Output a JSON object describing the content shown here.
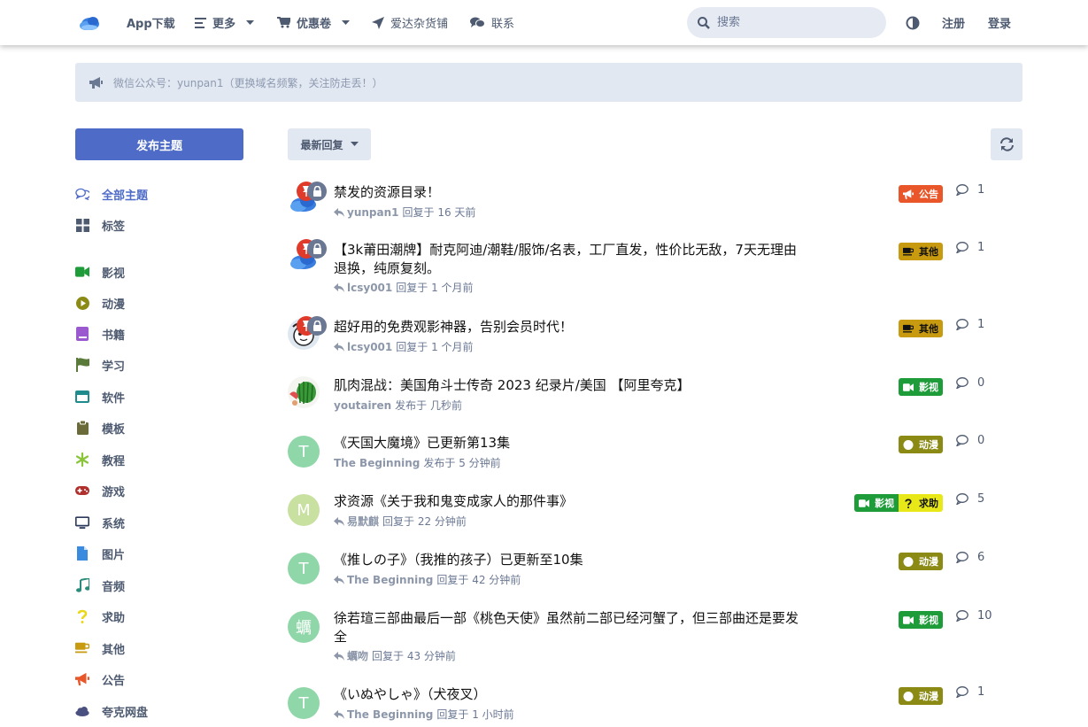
{
  "header": {
    "nav": [
      {
        "label": "App下载",
        "icon": "none",
        "has_caret": false
      },
      {
        "label": "更多",
        "icon": "list-icon",
        "has_caret": true
      },
      {
        "label": "优惠卷",
        "icon": "cart-icon",
        "has_caret": true
      },
      {
        "label": "爱达杂货铺",
        "icon": "paper-plane-icon",
        "has_caret": false
      },
      {
        "label": "联系",
        "icon": "comments-icon",
        "has_caret": false
      }
    ],
    "search_placeholder": "搜索",
    "register": "注册",
    "login": "登录"
  },
  "notice": {
    "text": "微信公众号：yunpan1（更换域名频繁，关注防走丢！）"
  },
  "sidebar": {
    "post_button": "发布主题",
    "items": [
      {
        "label": "全部主题",
        "icon": "comments-icon",
        "color": "#4d6bc7",
        "active": true
      },
      {
        "label": "标签",
        "icon": "grid-icon",
        "color": "#4d5a70",
        "active": false
      },
      {
        "label": "影视",
        "icon": "video-camera-icon",
        "color": "#1e9c3a",
        "active": false
      },
      {
        "label": "动漫",
        "icon": "play-circle-icon",
        "color": "#8a8a15",
        "active": false
      },
      {
        "label": "书籍",
        "icon": "book-icon",
        "color": "#9b59d0",
        "active": false
      },
      {
        "label": "学习",
        "icon": "flag-icon",
        "color": "#5a7a3a",
        "active": false
      },
      {
        "label": "软件",
        "icon": "window-icon",
        "color": "#1e8c8c",
        "active": false
      },
      {
        "label": "模板",
        "icon": "clipboard-icon",
        "color": "#6b6b3a",
        "active": false
      },
      {
        "label": "教程",
        "icon": "snowflake-icon",
        "color": "#8ac43a",
        "active": false
      },
      {
        "label": "游戏",
        "icon": "gamepad-icon",
        "color": "#b0302e",
        "active": false
      },
      {
        "label": "系统",
        "icon": "desktop-icon",
        "color": "#2c3a5e",
        "active": false
      },
      {
        "label": "图片",
        "icon": "file-icon",
        "color": "#3a8ae0",
        "active": false
      },
      {
        "label": "音频",
        "icon": "music-icon",
        "color": "#2c8c7c",
        "active": false
      },
      {
        "label": "求助",
        "icon": "question-icon",
        "color": "#e8d818",
        "active": false
      },
      {
        "label": "其他",
        "icon": "coffee-icon",
        "color": "#c89a10",
        "active": false
      },
      {
        "label": "公告",
        "icon": "bullhorn-icon",
        "color": "#e8562a",
        "active": false
      },
      {
        "label": "夸克网盘",
        "icon": "cloud-icon",
        "color": "#4a5080",
        "active": false
      }
    ]
  },
  "toolbar": {
    "sort_label": "最新回复"
  },
  "colors": {
    "accent": "#4d6bc7",
    "tag_notice": "#e8562a",
    "tag_other": "#c89a10",
    "tag_video": "#1e9c3a",
    "tag_anime": "#8a8a15",
    "tag_help": "#e8d818"
  },
  "discussions": [
    {
      "title": "禁发的资源目录！",
      "user": "yunpan1",
      "action_text": "回复于 16 天前",
      "is_reply": true,
      "tags": [
        {
          "label": "公告",
          "color": "#e8562a",
          "icon": "bullhorn-icon",
          "text_color": "#fff"
        }
      ],
      "replies": "1",
      "avatar_type": "cloud",
      "locked": true
    },
    {
      "title": "【3k莆田潮牌】耐克阿迪/潮鞋/服饰/名表，工厂直发，性价比无敌，7天无理由退换，纯原复刻。",
      "user": "lcsy001",
      "action_text": "回复于 1 个月前",
      "is_reply": true,
      "tags": [
        {
          "label": "其他",
          "color": "#c89a10",
          "icon": "coffee-icon",
          "text_color": "#111"
        }
      ],
      "replies": "1",
      "avatar_type": "cloud",
      "locked": true
    },
    {
      "title": "超好用的免费观影神器，告别会员时代！",
      "user": "lcsy001",
      "action_text": "回复于 1 个月前",
      "is_reply": true,
      "tags": [
        {
          "label": "其他",
          "color": "#c89a10",
          "icon": "coffee-icon",
          "text_color": "#111"
        }
      ],
      "replies": "1",
      "avatar_type": "cartoon",
      "locked": true
    },
    {
      "title": "肌肉混战：美国角斗士传奇 2023 纪录片/美国 【阿里夸克】",
      "user": "youtairen",
      "action_text": "发布于 几秒前",
      "is_reply": false,
      "tags": [
        {
          "label": "影视",
          "color": "#1e9c3a",
          "icon": "video-camera-icon",
          "text_color": "#fff"
        }
      ],
      "replies": "0",
      "avatar_type": "watermelon",
      "locked": false
    },
    {
      "title": "《天国大魔境》已更新第13集",
      "user": "The Beginning",
      "action_text": "发布于 5 分钟前",
      "is_reply": false,
      "tags": [
        {
          "label": "动漫",
          "color": "#8a8a15",
          "icon": "play-circle-icon",
          "text_color": "#fff"
        }
      ],
      "replies": "0",
      "avatar_type": "letter",
      "avatar_letter": "T",
      "avatar_color": "#8fd6a8",
      "locked": false
    },
    {
      "title": "求资源《关于我和鬼变成家人的那件事》",
      "user": "易默麒",
      "action_text": "回复于 22 分钟前",
      "is_reply": true,
      "tags": [
        {
          "label": "影视",
          "color": "#1e9c3a",
          "icon": "video-camera-icon",
          "text_color": "#fff"
        },
        {
          "label": "求助",
          "color": "#e8e818",
          "icon": "question-icon",
          "text_color": "#111"
        }
      ],
      "replies": "5",
      "avatar_type": "letter",
      "avatar_letter": "M",
      "avatar_color": "#c8e0a0",
      "locked": false
    },
    {
      "title": "《推しの子》（我推的孩子）已更新至10集",
      "user": "The Beginning",
      "action_text": "回复于 42 分钟前",
      "is_reply": true,
      "tags": [
        {
          "label": "动漫",
          "color": "#8a8a15",
          "icon": "play-circle-icon",
          "text_color": "#fff"
        }
      ],
      "replies": "6",
      "avatar_type": "letter",
      "avatar_letter": "T",
      "avatar_color": "#8fd6a8",
      "locked": false
    },
    {
      "title": "徐若瑄三部曲最后一部《桃色天使》虽然前二部已经河蟹了，但三部曲还是要发全",
      "user": "蠣吻",
      "action_text": "回复于 43 分钟前",
      "is_reply": true,
      "tags": [
        {
          "label": "影视",
          "color": "#1e9c3a",
          "icon": "video-camera-icon",
          "text_color": "#fff"
        }
      ],
      "replies": "10",
      "avatar_type": "letter",
      "avatar_letter": "蠣",
      "avatar_color": "#8fd6a8",
      "locked": false
    },
    {
      "title": "《いぬやしゃ》（犬夜叉）",
      "user": "The Beginning",
      "action_text": "回复于 1 小时前",
      "is_reply": true,
      "tags": [
        {
          "label": "动漫",
          "color": "#8a8a15",
          "icon": "play-circle-icon",
          "text_color": "#fff"
        }
      ],
      "replies": "1",
      "avatar_type": "letter",
      "avatar_letter": "T",
      "avatar_color": "#8fd6a8",
      "locked": false
    }
  ]
}
